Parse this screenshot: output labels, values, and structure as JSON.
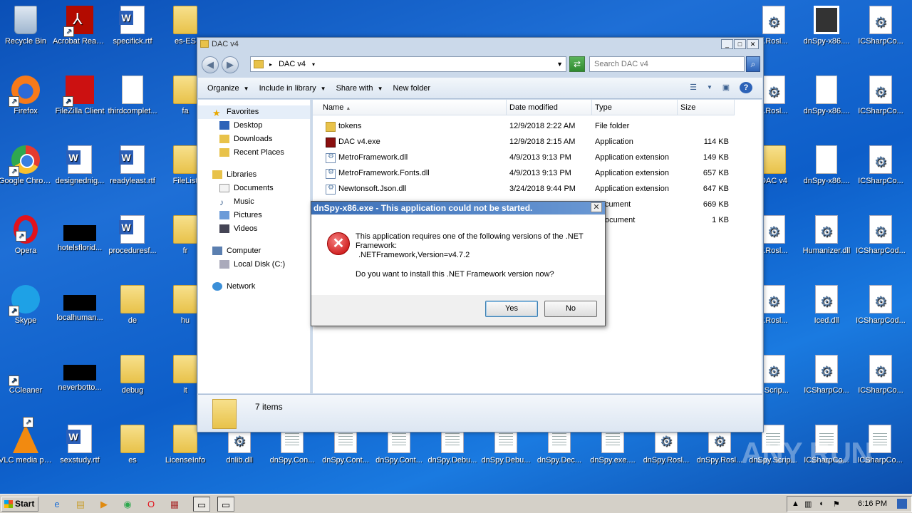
{
  "desktop": {
    "col1": [
      "Recycle Bin",
      "Firefox",
      "Google Chrome",
      "Opera",
      "Skype",
      "CCleaner",
      "VLC media player"
    ],
    "col2": [
      "Acrobat Reader DC",
      "FileZilla Client",
      "designednig...",
      "hotelsflorid...",
      "localhuman...",
      "neverbotto...",
      "sexstudy.rtf"
    ],
    "col3": [
      "specifick.rtf",
      "thirdcomplet...",
      "readyleast.rtf",
      "proceduresf...",
      "de",
      "debug",
      "es"
    ],
    "col4": [
      "es-ES",
      "fa",
      "FileList",
      "fr",
      "hu",
      "it",
      "LicenseInfo"
    ],
    "col5_bottom": "dnlib.dll",
    "bottom_row": [
      "dnSpy.Con...",
      "dnSpy.Cont...",
      "dnSpy.Cont...",
      "dnSpy.Debu...",
      "dnSpy.Debu...",
      "dnSpy.Dec...",
      "dnSpy.exe....",
      "dnSpy.Rosl...",
      "dnSpy.Rosl...",
      "dnSpy.Scrip...",
      "ICSharpCo...",
      "ICSharpCo..."
    ],
    "right_a": [
      "y.Rosl...",
      "y.Rosl...",
      "DAC v4",
      "y.Rosl...",
      "y.Rosl...",
      "y.Scrip..."
    ],
    "right_b": [
      "dnSpy-x86....",
      "dnSpy-x86....",
      "dnSpy-x86....",
      "Humanizer.dll",
      "Iced.dll",
      "ICSharpCo..."
    ],
    "right_c": [
      "ICSharpCo...",
      "ICSharpCo...",
      "ICSharpCo...",
      "ICSharpCod...",
      "ICSharpCod...",
      "ICSharpCo..."
    ]
  },
  "explorer": {
    "title": "DAC v4",
    "address": "DAC v4",
    "search_placeholder": "Search DAC v4",
    "toolbar": {
      "organize": "Organize",
      "include": "Include in library",
      "share": "Share with",
      "newfolder": "New folder"
    },
    "nav": {
      "favorites": "Favorites",
      "desktop": "Desktop",
      "downloads": "Downloads",
      "recent": "Recent Places",
      "libraries": "Libraries",
      "documents": "Documents",
      "music": "Music",
      "pictures": "Pictures",
      "videos": "Videos",
      "computer": "Computer",
      "localdisk": "Local Disk (C:)",
      "network": "Network"
    },
    "columns": {
      "name": "Name",
      "date": "Date modified",
      "type": "Type",
      "size": "Size"
    },
    "files": [
      {
        "name": "tokens",
        "date": "12/9/2018 2:22 AM",
        "type": "File folder",
        "size": ""
      },
      {
        "name": "DAC v4.exe",
        "date": "12/9/2018 2:15 AM",
        "type": "Application",
        "size": "114 KB"
      },
      {
        "name": "MetroFramework.dll",
        "date": "4/9/2013 9:13 PM",
        "type": "Application extension",
        "size": "149 KB"
      },
      {
        "name": "MetroFramework.Fonts.dll",
        "date": "4/9/2013 9:13 PM",
        "type": "Application extension",
        "size": "657 KB"
      },
      {
        "name": "Newtonsoft.Json.dll",
        "date": "3/24/2018 9:44 PM",
        "type": "Application extension",
        "size": "647 KB"
      },
      {
        "name": "",
        "date": "",
        "type": "Document",
        "size": "669 KB"
      },
      {
        "name": "",
        "date": "",
        "type": "t Document",
        "size": "1 KB"
      }
    ],
    "status": "7 items"
  },
  "dialog": {
    "title": "dnSpy-x86.exe - This application could not be started.",
    "line1": "This application requires one of the following versions of the .NET Framework:",
    "line2": ".NETFramework,Version=v4.7.2",
    "line3": "Do you want to install this .NET Framework version now?",
    "yes": "Yes",
    "no": "No"
  },
  "taskbar": {
    "start": "Start",
    "clock": "6:16 PM"
  },
  "watermark": "ANY RUN"
}
